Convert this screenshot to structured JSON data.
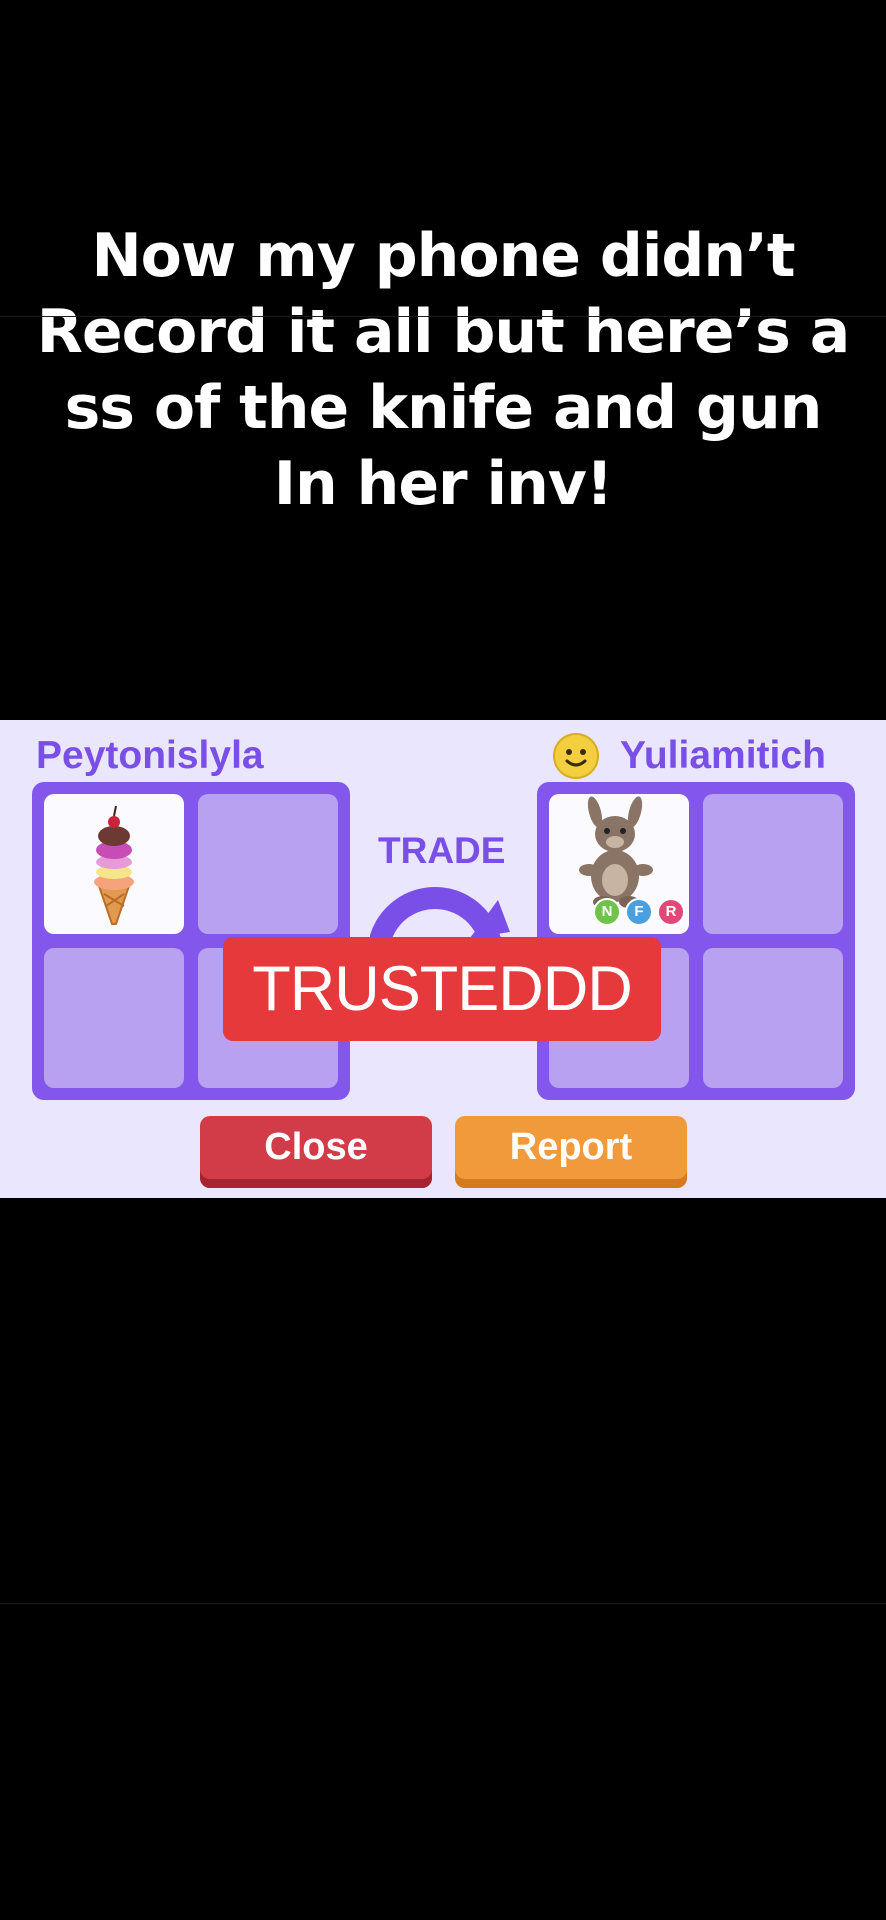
{
  "caption": {
    "lines": [
      "Now my phone didn’t",
      "Record it all but here’s a",
      "ss of the knife and gun",
      "In her inv!"
    ]
  },
  "trade": {
    "title": "TRADE",
    "left_player": {
      "name": "Peytonislyla",
      "items": [
        "ice-cream-cone-icon"
      ]
    },
    "right_player": {
      "name": "Yuliamitich",
      "avatar": "smiley-face-icon",
      "items": [
        "kangaroo-pet-icon"
      ]
    },
    "pet_badges": [
      "N",
      "F",
      "R"
    ],
    "overlay_label": "TRUSTEDDD",
    "close_label": "Close",
    "report_label": "Report"
  },
  "colors": {
    "panel_bg": "#e9e6fd",
    "accent_purple": "#7a4fe8",
    "grid_purple": "#8357eb",
    "slot_purple": "#b8a1f1",
    "stamp_red": "#e6393c",
    "close_red": "#d23c48",
    "report_orange": "#f09a3c"
  }
}
